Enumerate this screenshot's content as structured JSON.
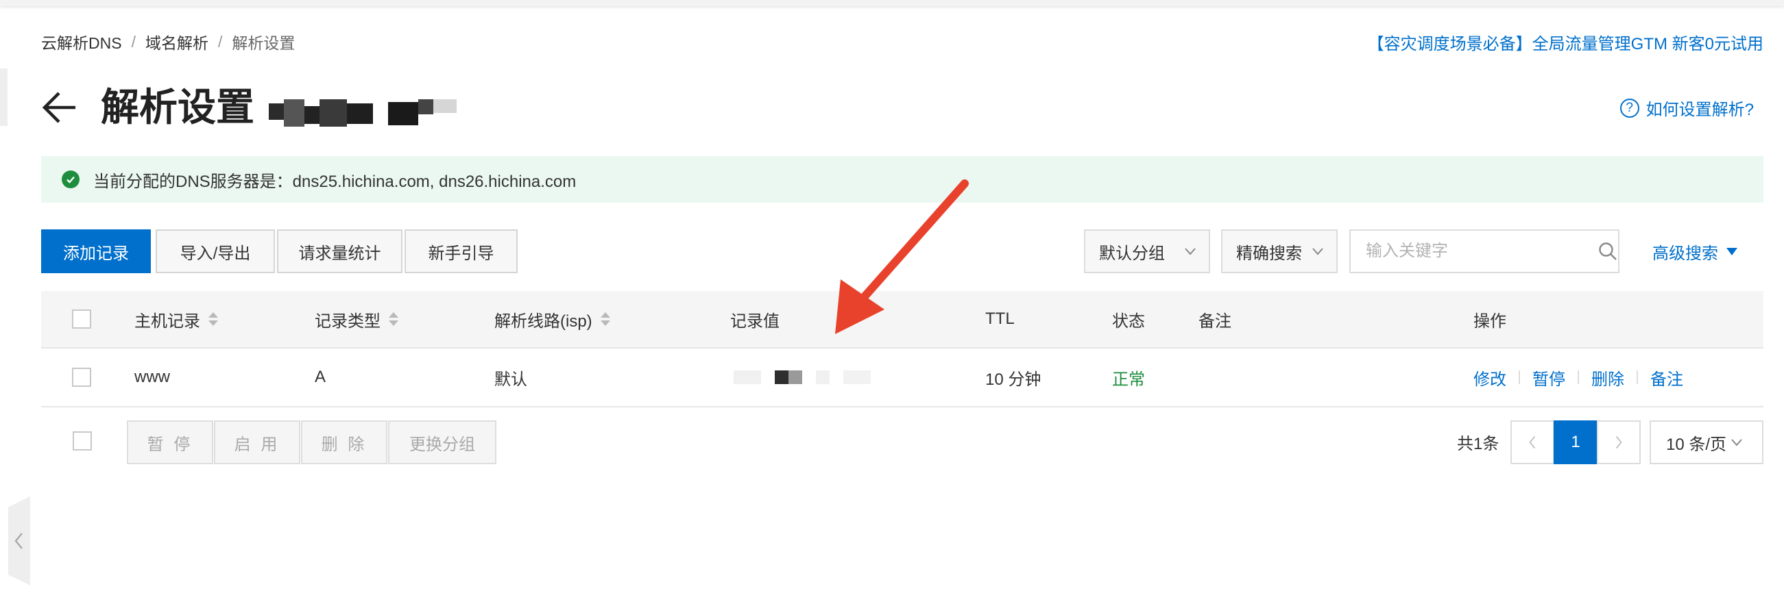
{
  "breadcrumb": {
    "items": [
      "云解析DNS",
      "域名解析",
      "解析设置"
    ],
    "separator": "/"
  },
  "promo": "【容灾调度场景必备】全局流量管理GTM 新客0元试用",
  "header": {
    "title": "解析设置",
    "help": "如何设置解析?",
    "help_icon_glyph": "?"
  },
  "notice": {
    "text": "当前分配的DNS服务器是：dns25.hichina.com, dns26.hichina.com"
  },
  "toolbar": {
    "add": "添加记录",
    "import_export": "导入/导出",
    "stats": "请求量统计",
    "guide": "新手引导",
    "group_select": "默认分组",
    "precise_search": "精确搜索",
    "search_placeholder": "输入关键字",
    "advanced_search": "高级搜索"
  },
  "table": {
    "columns": {
      "host": "主机记录",
      "type": "记录类型",
      "line": "解析线路(isp)",
      "value": "记录值",
      "ttl": "TTL",
      "status": "状态",
      "remark": "备注",
      "actions": "操作"
    },
    "rows": [
      {
        "host": "www",
        "type": "A",
        "line": "默认",
        "ttl": "10 分钟",
        "status": "正常",
        "actions": [
          "修改",
          "暂停",
          "删除",
          "备注"
        ]
      }
    ]
  },
  "batch": {
    "pause": "暂 停",
    "enable": "启 用",
    "delete": "删 除",
    "change_group": "更换分组"
  },
  "pagination": {
    "total": "共1条",
    "current": "1",
    "page_size": "10 条/页",
    "prev_glyph": "‹",
    "next_glyph": "›"
  },
  "colors": {
    "accent": "#0070cc",
    "success": "#1e8e3e",
    "notice_bg": "#ebf8f2",
    "annotation_arrow": "#e8412c"
  }
}
